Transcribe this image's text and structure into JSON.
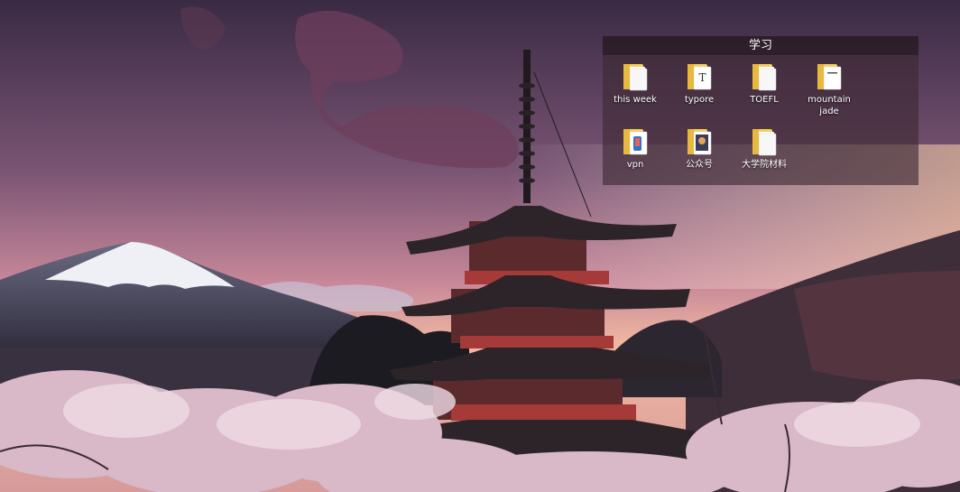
{
  "fence": {
    "title": "学习",
    "items": [
      {
        "label": "this week",
        "icon": "folder-icon"
      },
      {
        "label": "typore",
        "icon": "folder-typora-icon"
      },
      {
        "label": "TOEFL",
        "icon": "folder-icon"
      },
      {
        "label": "mountain\njade",
        "icon": "folder-icon"
      },
      {
        "label": "vpn",
        "icon": "folder-vpn-icon"
      },
      {
        "label": "公众号",
        "icon": "folder-photo-icon"
      },
      {
        "label": "大学院材料",
        "icon": "folder-icon"
      }
    ]
  },
  "colors": {
    "sky_top": "#3a2a44",
    "sky_mid": "#8a5f7c",
    "horizon": "#f0b8a0",
    "folder": "#f3cf5e",
    "fence_bg": "#3c2832"
  }
}
